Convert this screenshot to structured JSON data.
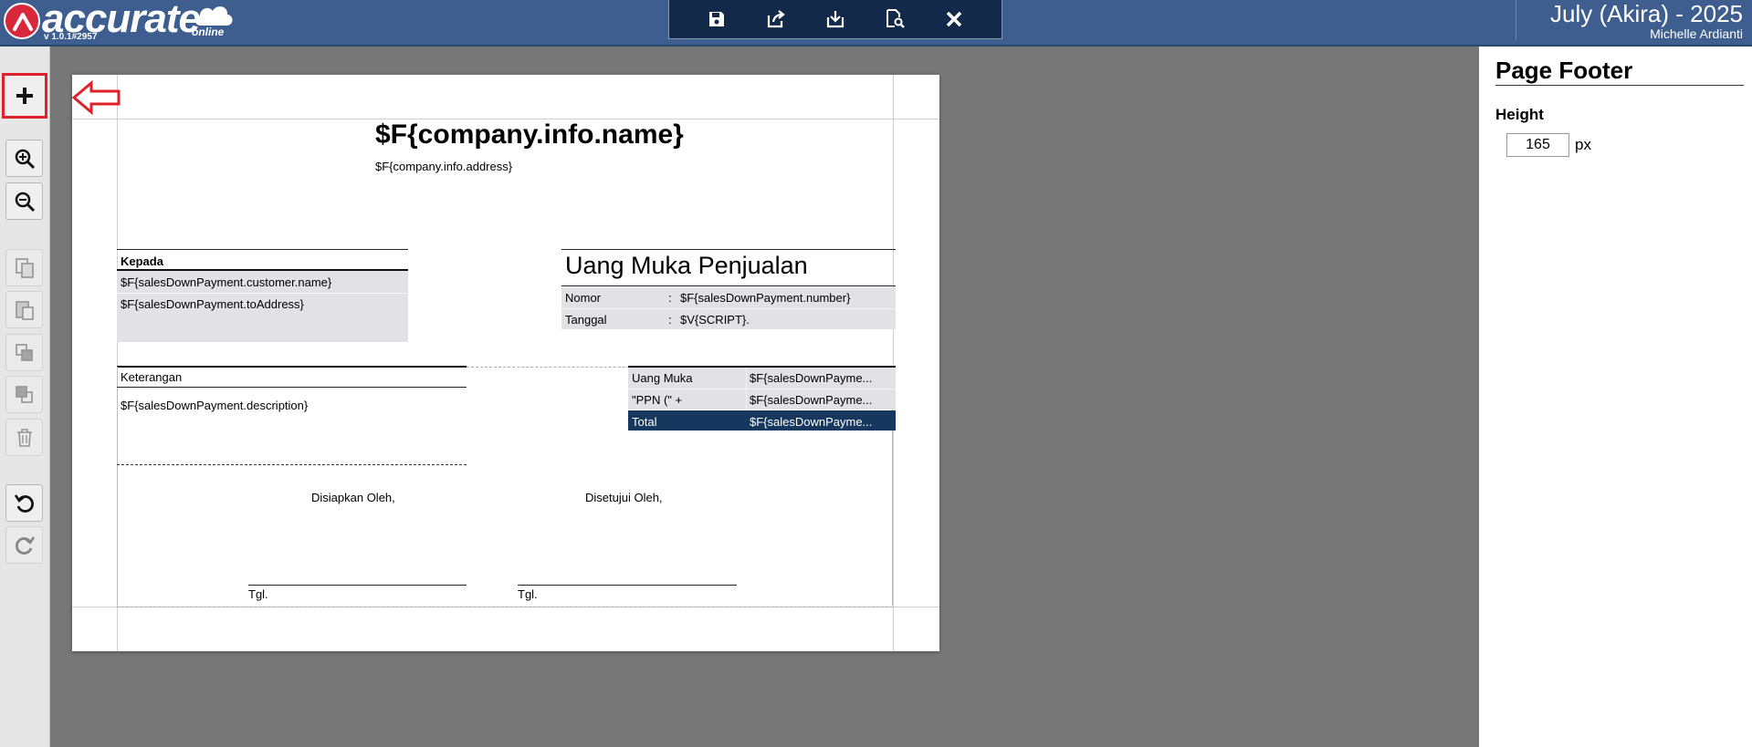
{
  "app": {
    "logo_text": "accurate",
    "logo_sub": "online",
    "version": "v 1.0.1#2957",
    "period": "July (Akira) - 2025",
    "user": "Michelle Ardianti"
  },
  "toolbar": {
    "icons": [
      "save-icon",
      "export-icon",
      "download-icon",
      "preview-icon",
      "close-icon"
    ]
  },
  "left_tools": {
    "icons": [
      "add-icon",
      "zoom-in-icon",
      "zoom-out-icon",
      "copy-icon",
      "paste-icon",
      "bring-front-icon",
      "send-back-icon",
      "delete-icon",
      "undo-icon",
      "redo-icon"
    ]
  },
  "report": {
    "company_name": "$F{company.info.name}",
    "company_address": "$F{company.info.address}",
    "kepada_label": "Kepada",
    "customer_name": "$F{salesDownPayment.customer.name}",
    "to_address": "$F{salesDownPayment.toAddress}",
    "doc_title": "Uang Muka Penjualan",
    "nomor_label": "Nomor",
    "nomor_colon": ":",
    "nomor_value": "$F{salesDownPayment.number}",
    "tanggal_label": "Tanggal",
    "tanggal_colon": ":",
    "tanggal_value": "$V{SCRIPT}.",
    "keterangan_label": "Keterangan",
    "description": "$F{salesDownPayment.description}",
    "summary": [
      {
        "label": "Uang Muka",
        "value": "$F{salesDownPayme..."
      },
      {
        "label": "\"PPN (\" +",
        "value": "$F{salesDownPayme..."
      },
      {
        "label": "Total",
        "value": "$F{salesDownPayme..."
      }
    ],
    "prepared_by": "Disiapkan Oleh,",
    "approved_by": "Disetujui Oleh,",
    "tgl1": "Tgl.",
    "tgl2": "Tgl."
  },
  "panel": {
    "title": "Page Footer",
    "height_label": "Height",
    "height_value": "165",
    "height_unit": "px"
  },
  "colors": {
    "topbar": "#3d5e8e",
    "toolbar": "#13294a",
    "total_row": "#16375e",
    "highlight": "#e0202a"
  }
}
